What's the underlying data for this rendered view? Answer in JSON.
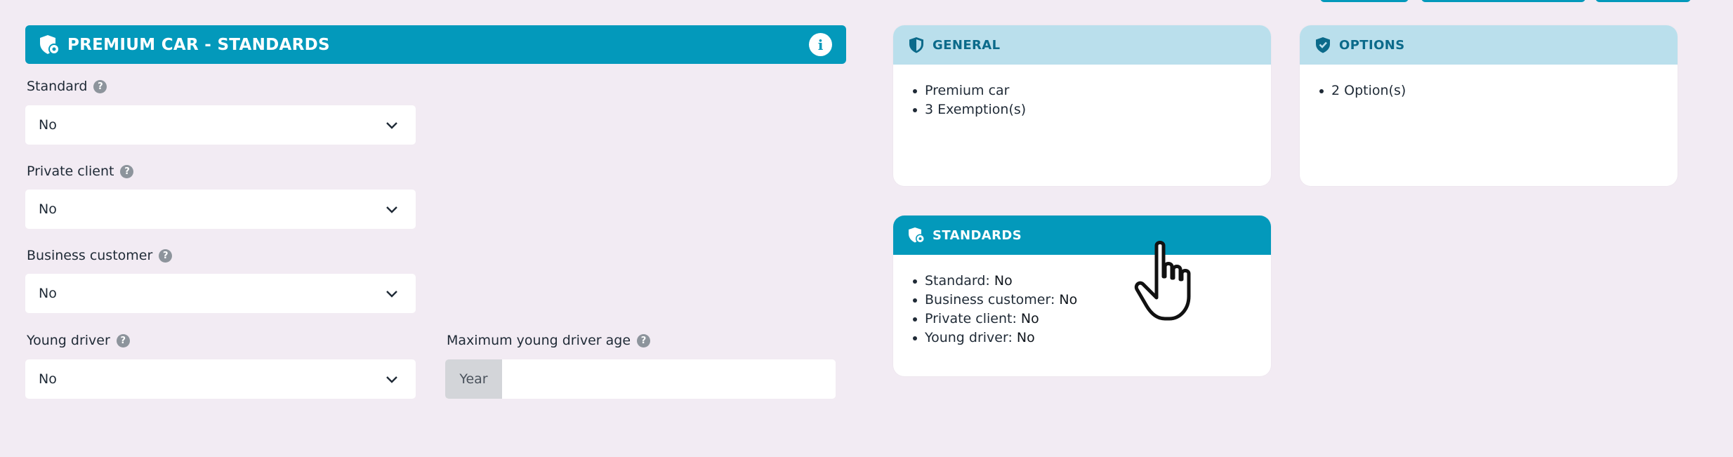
{
  "form": {
    "title": "PREMIUM CAR - STANDARDS",
    "fields": [
      {
        "label": "Standard",
        "value": "No"
      },
      {
        "label": "Private client",
        "value": "No"
      },
      {
        "label": "Business customer",
        "value": "No"
      },
      {
        "label": "Young driver",
        "value": "No"
      }
    ],
    "max_age": {
      "label": "Maximum young driver age",
      "addon": "Year",
      "value": ""
    },
    "help_glyph": "?",
    "info_glyph": "i"
  },
  "cards": {
    "general": {
      "title": "GENERAL",
      "items": [
        "Premium car",
        "3 Exemption(s)"
      ]
    },
    "options": {
      "title": "OPTIONS",
      "items": [
        "2 Option(s)"
      ]
    },
    "standards": {
      "title": "STANDARDS",
      "items": [
        {
          "label": "Standard:",
          "value": "No"
        },
        {
          "label": "Business customer:",
          "value": "No"
        },
        {
          "label": "Private client:",
          "value": "No"
        },
        {
          "label": "Young driver:",
          "value": "No"
        }
      ]
    }
  },
  "colors": {
    "accent": "#0399bb",
    "light_header": "#badfec",
    "background": "#f2ebf3"
  }
}
